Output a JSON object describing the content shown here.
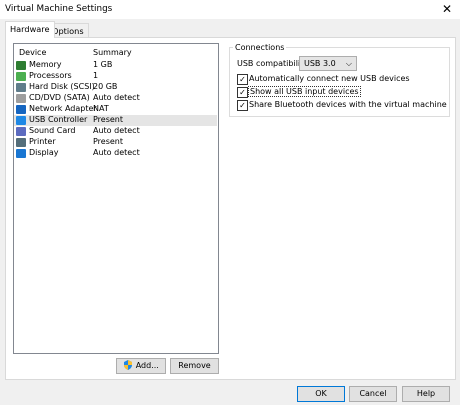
{
  "window": {
    "title": "Virtual Machine Settings"
  },
  "tabs": [
    {
      "label": "Hardware"
    },
    {
      "label": "Options"
    }
  ],
  "device_list": {
    "headers": {
      "device": "Device",
      "summary": "Summary"
    },
    "rows": [
      {
        "device": "Memory",
        "summary": "1 GB",
        "icon": "memory-icon",
        "color": "#2e7d32"
      },
      {
        "device": "Processors",
        "summary": "1",
        "icon": "processor-icon",
        "color": "#4caf50"
      },
      {
        "device": "Hard Disk (SCSI)",
        "summary": "20 GB",
        "icon": "hard-disk-icon",
        "color": "#607d8b"
      },
      {
        "device": "CD/DVD (SATA)",
        "summary": "Auto detect",
        "icon": "cd-dvd-icon",
        "color": "#9e9e9e"
      },
      {
        "device": "Network Adapter",
        "summary": "NAT",
        "icon": "network-adapter-icon",
        "color": "#1565c0"
      },
      {
        "device": "USB Controller",
        "summary": "Present",
        "icon": "usb-controller-icon",
        "color": "#1e88e5",
        "selected": true
      },
      {
        "device": "Sound Card",
        "summary": "Auto detect",
        "icon": "sound-card-icon",
        "color": "#5c6bc0"
      },
      {
        "device": "Printer",
        "summary": "Present",
        "icon": "printer-icon",
        "color": "#546e7a"
      },
      {
        "device": "Display",
        "summary": "Auto detect",
        "icon": "display-icon",
        "color": "#1976d2"
      }
    ]
  },
  "buttons": {
    "add": "Add...",
    "remove": "Remove",
    "ok": "OK",
    "cancel": "Cancel",
    "help": "Help"
  },
  "connections": {
    "legend": "Connections",
    "usb_compat_label": "USB compatibility:",
    "usb_compat_value": "USB 3.0",
    "auto_connect_label": "Automatically connect new USB devices",
    "show_all_label": "Show all USB input devices",
    "share_bt_label": "Share Bluetooth devices with the virtual machine"
  }
}
